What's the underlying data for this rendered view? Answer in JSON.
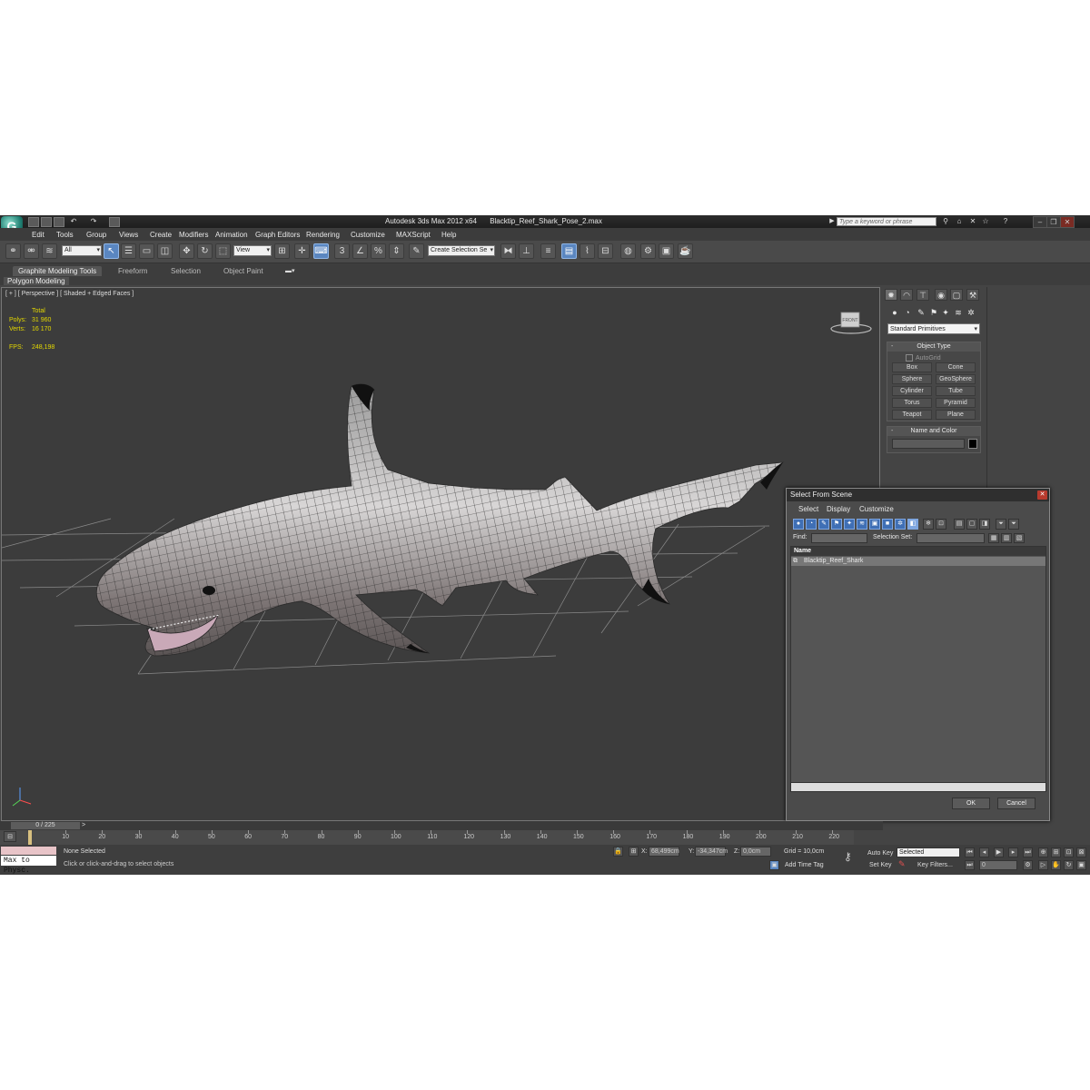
{
  "window": {
    "app_name": "Autodesk 3ds Max  2012 x64",
    "file_name": "Blacktip_Reef_Shark_Pose_2.max",
    "search_placeholder": "Type a keyword or phrase"
  },
  "menu": [
    "Edit",
    "Tools",
    "Group",
    "Views",
    "Create",
    "Modifiers",
    "Animation",
    "Graph Editors",
    "Rendering",
    "Customize",
    "MAXScript",
    "Help"
  ],
  "toolbar": {
    "selection_filter": "All",
    "ref_coord": "View",
    "angle_snap_label": "3",
    "named_selection": "Create Selection Se"
  },
  "ribbon": {
    "tabs": [
      "Graphite Modeling Tools",
      "Freeform",
      "Selection",
      "Object Paint"
    ],
    "panel": "Polygon Modeling"
  },
  "viewport": {
    "label": "[ + ] [ Perspective ] [ Shaded + Edged Faces ]",
    "stats": {
      "total_label": "Total",
      "polys_label": "Polys:",
      "polys_value": "31 960",
      "verts_label": "Verts:",
      "verts_value": "16 170",
      "fps_label": "FPS:",
      "fps_value": "248,198"
    },
    "viewcube_label": "FRONT"
  },
  "command_panel": {
    "dropdown": "Standard Primitives",
    "object_type_title": "Object Type",
    "autogrid": "AutoGrid",
    "buttons": [
      "Box",
      "Cone",
      "Sphere",
      "GeoSphere",
      "Cylinder",
      "Tube",
      "Torus",
      "Pyramid",
      "Teapot",
      "Plane"
    ],
    "name_color_title": "Name and Color"
  },
  "dialog": {
    "title": "Select From Scene",
    "menu": [
      "Select",
      "Display",
      "Customize"
    ],
    "find_label": "Find:",
    "selection_set_label": "Selection Set:",
    "column_header": "Name",
    "objects": [
      "Blacktip_Reef_Shark"
    ],
    "ok": "OK",
    "cancel": "Cancel"
  },
  "timeline": {
    "frame_display": "0 / 225",
    "ticks": [
      "10",
      "20",
      "30",
      "40",
      "50",
      "60",
      "70",
      "80",
      "90",
      "100",
      "110",
      "120",
      "130",
      "140",
      "150",
      "160",
      "170",
      "180",
      "190",
      "200",
      "210",
      "220"
    ]
  },
  "status": {
    "maxscript_listener": "Max to Physc.",
    "selection_status": "None Selected",
    "prompt": "Click or click-and-drag to select objects",
    "x_label": "X:",
    "x_value": "68,499cm",
    "y_label": "Y:",
    "y_value": "-34,347cm",
    "z_label": "Z:",
    "z_value": "0,0cm",
    "grid": "Grid = 10,0cm",
    "add_time_tag": "Add Time Tag",
    "auto_key": "Auto Key",
    "set_key": "Set Key",
    "key_mode": "Selected",
    "key_filters": "Key Filters...",
    "current_frame": "0"
  },
  "colors": {
    "viewport_bg": "#3c3c3c",
    "stats_yellow": "#e4d800",
    "selection_blue": "#5a86c0"
  }
}
